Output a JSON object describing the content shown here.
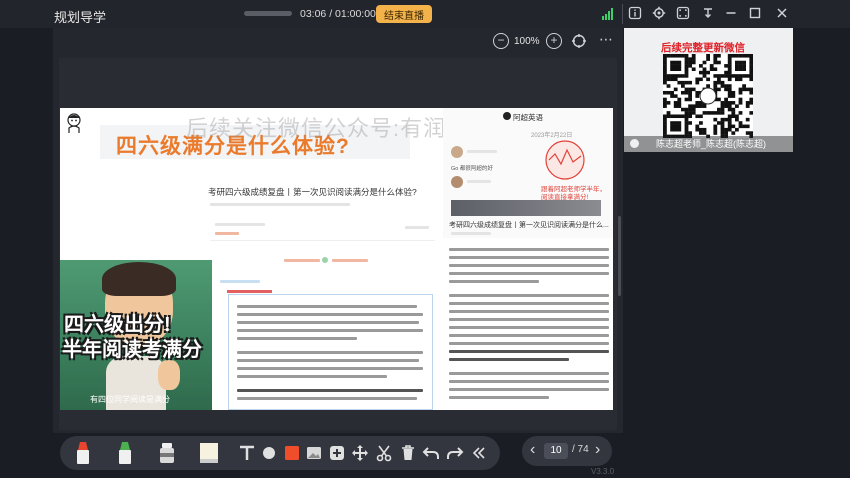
{
  "app": {
    "title": "规划导学"
  },
  "header": {
    "timer": "03:06 / 01:00:00",
    "end_live_label": "结束直播",
    "icons": [
      "signal-icon",
      "info-icon",
      "settings-icon",
      "fullscreen-icon",
      "minimize-icon",
      "maximize-icon",
      "close-icon"
    ]
  },
  "zoom": {
    "minus": "−",
    "value": "100%",
    "plus": "+"
  },
  "slide": {
    "watermark": "后续关注微信公众号:有润学社",
    "headline": "四六级满分是什么体验?",
    "left_article_title": "考研四六级成绩复盘丨第一次见识阅读满分是什么体验?",
    "right_panel": {
      "author": "阿超英语",
      "date": "2023年2月22日",
      "chat_item": "Go 都很阿超的好",
      "promo_text": "跟着阿超老师学半年，阅读直接拿满分!",
      "title": "考研四六级成绩复盘丨第一次见识阅读满分是什么..."
    },
    "promo": {
      "title": "四六级出分!",
      "subtitle": "半年阅读考满分",
      "caption": "有四位同学阅读是满分"
    }
  },
  "camera": {
    "headline": "后续完整更新微信",
    "label": "陈志超老师_陈志超(陈志超)"
  },
  "toolbar": {
    "tools": [
      "marker-red-icon",
      "marker-green-icon",
      "bucket-icon",
      "sticky-note-icon",
      "text-icon",
      "shape-icon",
      "rectangle-icon",
      "image-icon",
      "add-icon",
      "move-icon",
      "scissors-icon",
      "delete-icon",
      "undo-icon",
      "redo-icon",
      "collapse-icon"
    ]
  },
  "pager": {
    "prev": "‹",
    "current": "10",
    "total": "/ 74",
    "next": "›"
  },
  "version": "V3.3.0",
  "colors": {
    "accent": "#f3b24a",
    "brand_orange": "#ea7a2c",
    "signal": "#3fcf6a"
  }
}
